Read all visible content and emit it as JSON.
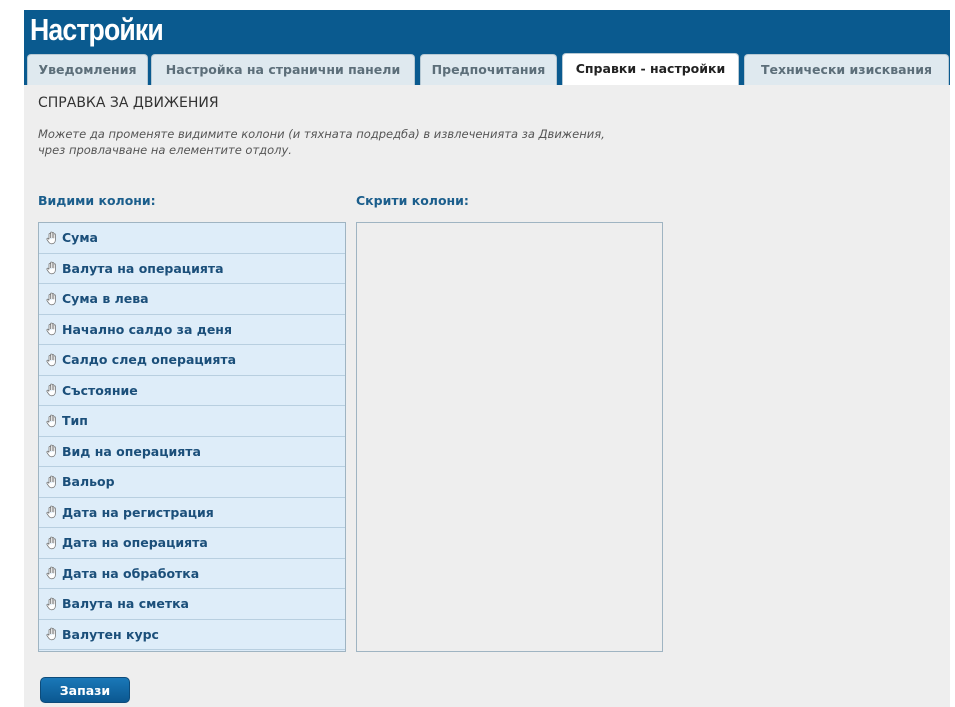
{
  "header": {
    "title": "Настройки"
  },
  "tabs": [
    {
      "label": "Уведомления",
      "active": false
    },
    {
      "label": "Настройка на странични панели",
      "active": false
    },
    {
      "label": "Предпочитания",
      "active": false
    },
    {
      "label": "Справки - настройки",
      "active": true
    },
    {
      "label": "Технически изисквания",
      "active": false
    }
  ],
  "section": {
    "title": "СПРАВКА ЗА ДВИЖЕНИЯ",
    "description": "Можете да променяте видимите колони (и тяхната подредба) в извлеченията за Движения, чрез провлачване на елементите отдолу."
  },
  "visible_columns": {
    "label": "Видими колони:",
    "items": [
      "Сума",
      "Валута на операцията",
      "Сума в лева",
      "Начално салдо за деня",
      "Салдо след операцията",
      "Състояние",
      "Тип",
      "Вид на операцията",
      "Вальор",
      "Дата на регистрация",
      "Дата на операцията",
      "Дата на обработка",
      "Валута на сметка",
      "Валутен курс"
    ]
  },
  "hidden_columns": {
    "label": "Скрити колони:",
    "items": []
  },
  "actions": {
    "save_label": "Запази"
  },
  "colors": {
    "header": "#0a5a8f",
    "accent": "#1b5e8c",
    "item_bg": "#deedf9",
    "content_bg": "#eeeeee"
  },
  "icons": {
    "drag_handle": "hand-icon"
  }
}
